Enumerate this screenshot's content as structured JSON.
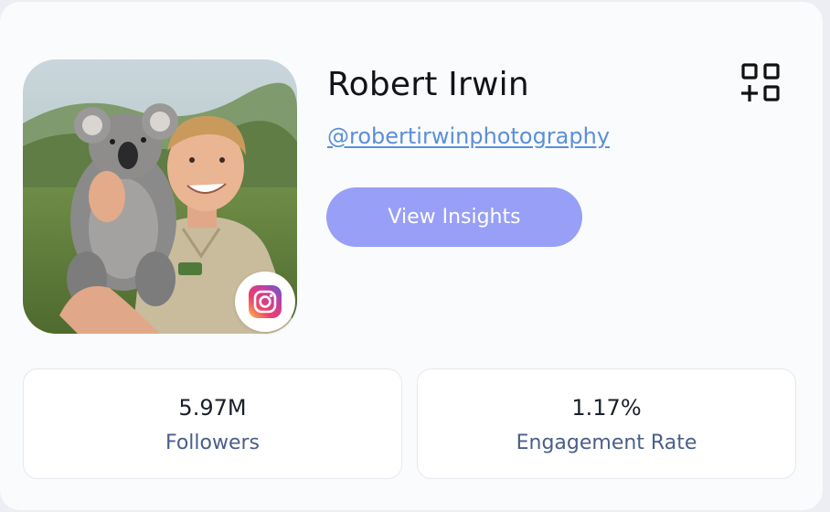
{
  "profile": {
    "name": "Robert Irwin",
    "handle": "@robertirwinphotography",
    "platform_icon": "instagram-icon",
    "avatar_alt": "Robert Irwin"
  },
  "actions": {
    "view_insights_label": "View Insights",
    "add_icon": "add-to-group-icon"
  },
  "stats": [
    {
      "value": "5.97M",
      "label": "Followers"
    },
    {
      "value": "1.17%",
      "label": "Engagement Rate"
    }
  ],
  "colors": {
    "accent_button": "#979ff7",
    "link": "#5b8fd9",
    "stat_label": "#4a5f88",
    "card_bg": "#fafbfc"
  }
}
